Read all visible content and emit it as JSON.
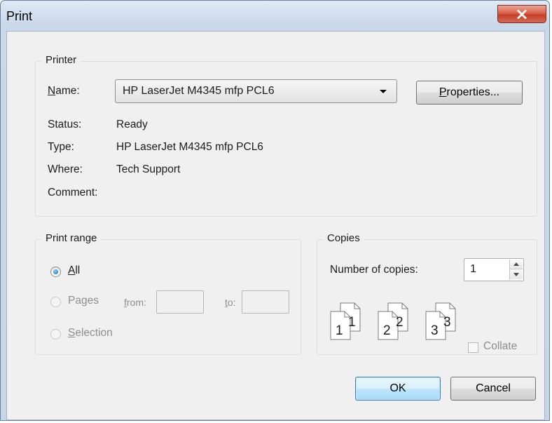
{
  "window": {
    "title": "Print"
  },
  "printer": {
    "group_label": "Printer",
    "name_label": "Name:",
    "name_value": "HP LaserJet M4345 mfp PCL6",
    "properties_label": "Properties...",
    "status_label": "Status:",
    "status_value": "Ready",
    "type_label": "Type:",
    "type_value": "HP LaserJet M4345 mfp PCL6",
    "where_label": "Where:",
    "where_value": "Tech Support",
    "comment_label": "Comment:",
    "comment_value": ""
  },
  "print_range": {
    "group_label": "Print range",
    "all_label": "All",
    "pages_label": "Pages",
    "from_label": "from:",
    "to_label": "to:",
    "from_value": "",
    "to_value": "",
    "selection_label": "Selection",
    "selected": "All"
  },
  "copies": {
    "group_label": "Copies",
    "number_label": "Number of copies:",
    "number_value": "1",
    "collate_label": "Collate",
    "collate_checked": false,
    "page_labels": [
      "1",
      "1",
      "2",
      "2",
      "3",
      "3"
    ]
  },
  "buttons": {
    "ok": "OK",
    "cancel": "Cancel"
  },
  "icons": {
    "close": "close-icon",
    "dropdown": "chevron-down-icon",
    "spin_up": "arrow-up-icon",
    "spin_down": "arrow-down-icon",
    "collate": "collate-pages-icon"
  }
}
